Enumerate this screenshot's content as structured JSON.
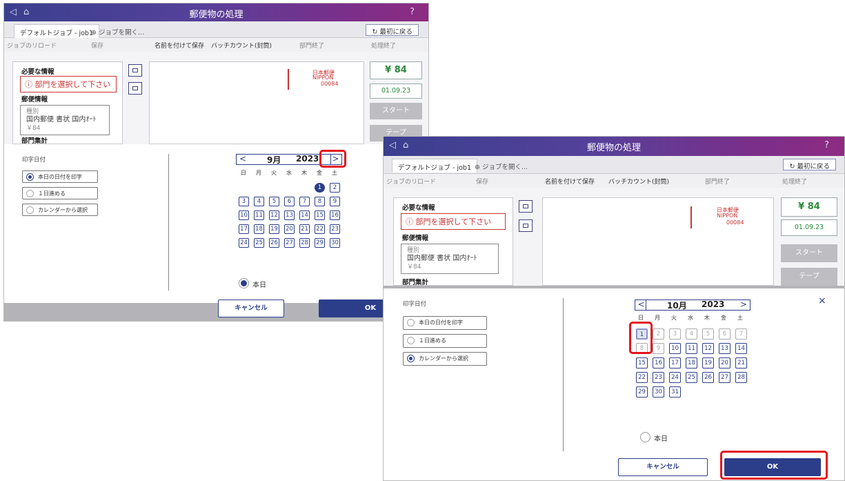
{
  "app": {
    "title": "郵便物の処理",
    "tab_active": "デフォルトジョブ - job1",
    "tab_open": "ジョブを開く...",
    "back_button": "最初に戻る"
  },
  "menu": [
    "ジョブのリロード",
    "保存",
    "名前を付けて保存",
    "バッチカウント(封筒)",
    "部門終了",
    "処理終了"
  ],
  "info": {
    "required_header": "必要な情報",
    "required_alert": "部門を選択して下さい",
    "mail_header": "郵便情報",
    "mail_type_label": "種別",
    "mail_type_value": "国内郵便 書状 国内ｵｰﾄ",
    "mail_price": "￥84",
    "dept_header": "部門集計"
  },
  "stamp": {
    "brand": "日本郵便",
    "brand_en": "NIPPON",
    "amount": "00084"
  },
  "right_panel": {
    "price": "¥ 84",
    "date": "01.09.23",
    "start_button": "スタート",
    "tape_button": "テープ"
  },
  "dialog": {
    "section_label": "印字日付",
    "options": [
      "本日の日付を印字",
      "１日進める",
      "カレンダーから選択"
    ],
    "weekdays": [
      "日",
      "月",
      "火",
      "水",
      "木",
      "金",
      "土"
    ],
    "today_label": "本日",
    "cancel_button": "キャンセル",
    "ok_button": "OK",
    "close_icon": "×"
  },
  "calendar1": {
    "month_label": "9月",
    "year": "2023",
    "selected_option": 0,
    "selected_day": "1",
    "weeks": [
      [
        "",
        "",
        "",
        "",
        "",
        "1",
        "2"
      ],
      [
        "3",
        "4",
        "5",
        "6",
        "7",
        "8",
        "9"
      ],
      [
        "10",
        "11",
        "12",
        "13",
        "14",
        "15",
        "16"
      ],
      [
        "17",
        "18",
        "19",
        "20",
        "21",
        "22",
        "23"
      ],
      [
        "24",
        "25",
        "26",
        "27",
        "28",
        "29",
        "30"
      ]
    ]
  },
  "calendar2": {
    "month_label": "10月",
    "year": "2023",
    "selected_option": 2,
    "highlight_day": "1",
    "weeks": [
      [
        "1",
        "2",
        "3",
        "4",
        "5",
        "6",
        "7"
      ],
      [
        "8",
        "9",
        "10",
        "11",
        "12",
        "13",
        "14"
      ],
      [
        "15",
        "16",
        "17",
        "18",
        "19",
        "20",
        "21"
      ],
      [
        "22",
        "23",
        "24",
        "25",
        "26",
        "27",
        "28"
      ],
      [
        "29",
        "30",
        "31",
        "",
        "",
        "",
        ""
      ]
    ]
  },
  "icons": {
    "back": "◁",
    "home": "⌂",
    "help": "?",
    "plus": "⊕",
    "refresh": "↻",
    "alert": "ⓘ",
    "prev": "<",
    "next": ">"
  }
}
